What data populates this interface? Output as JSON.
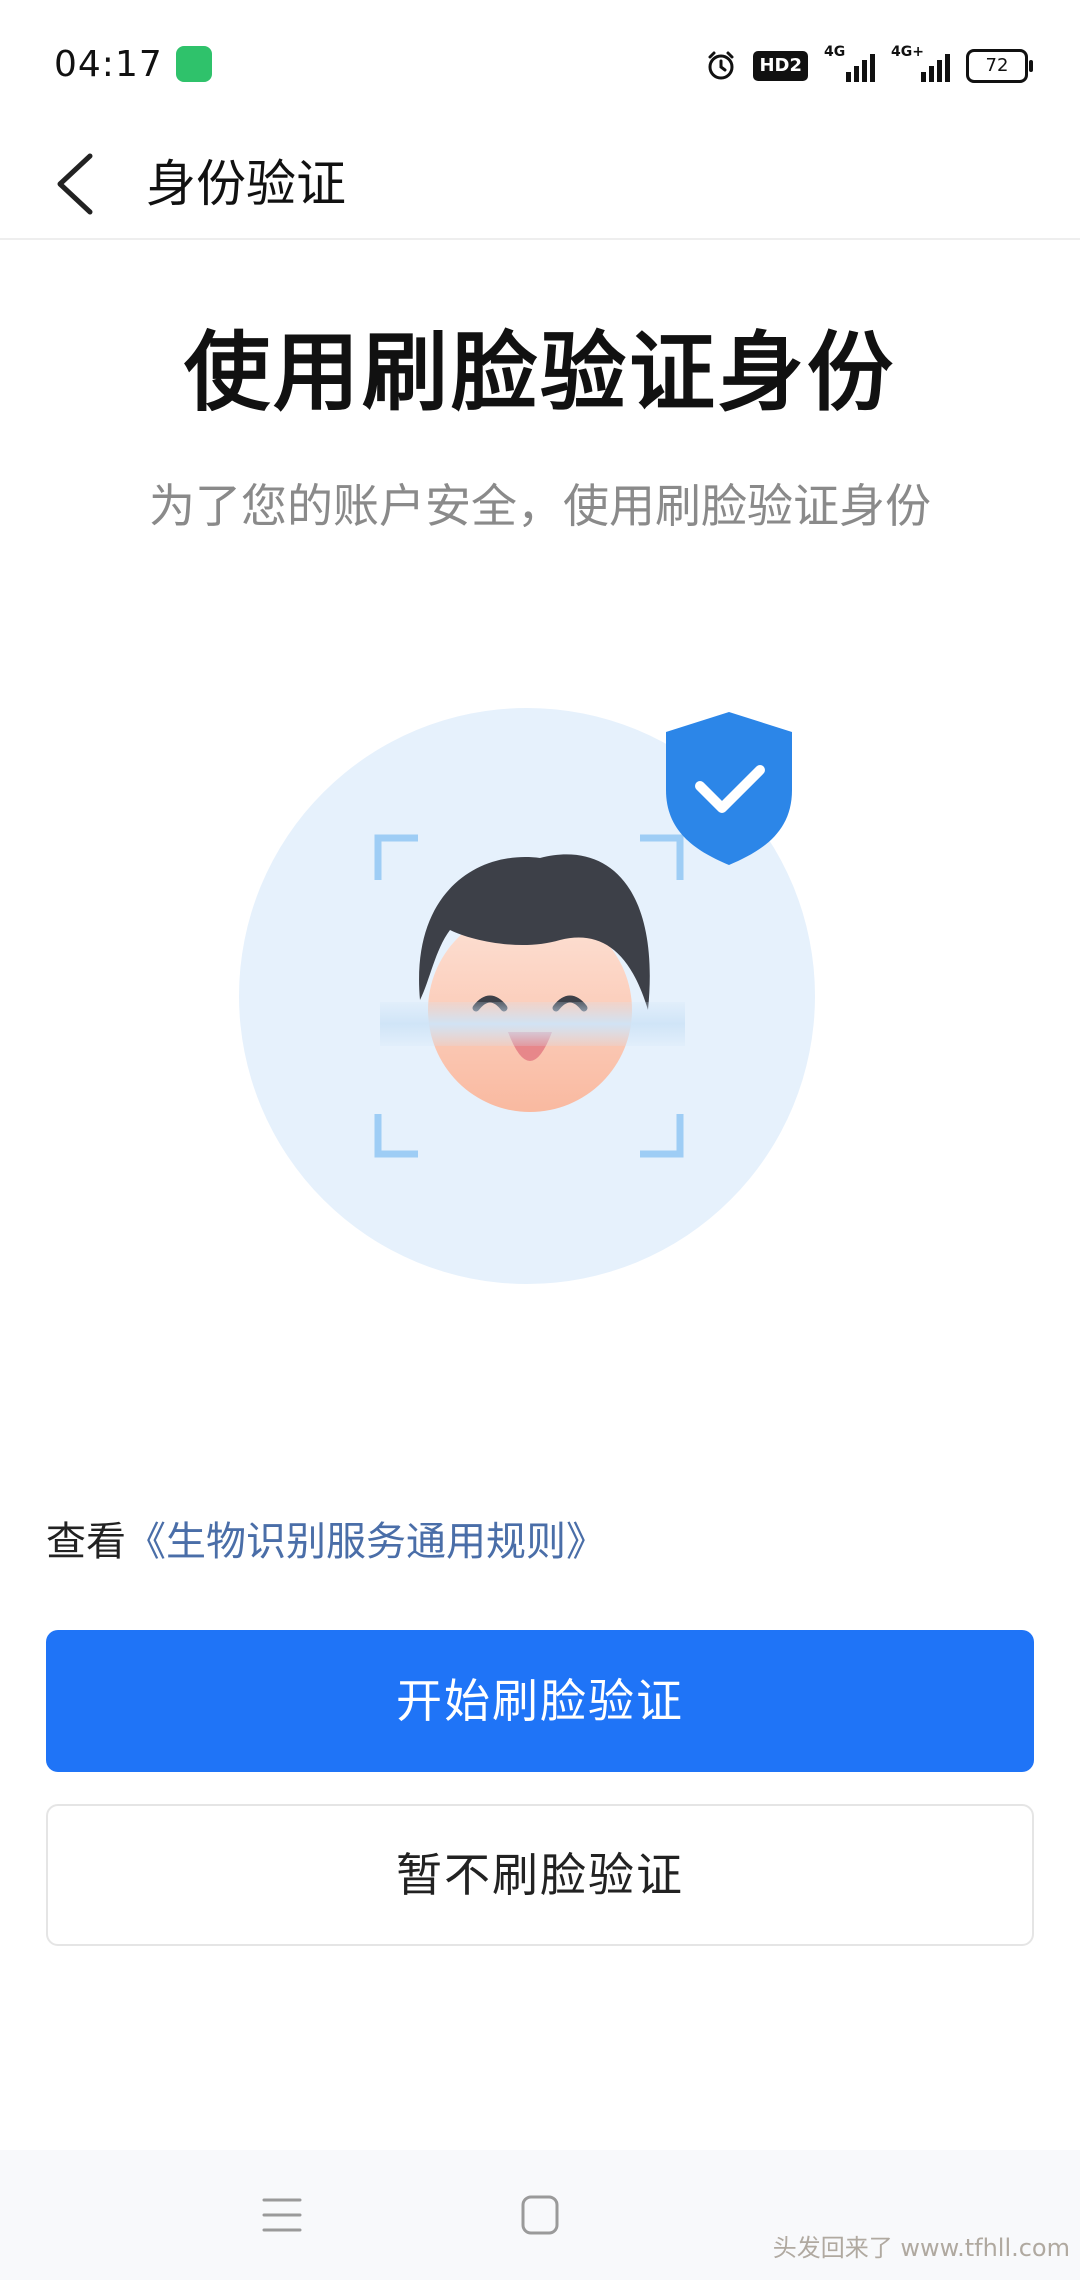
{
  "status_bar": {
    "time": "04:17",
    "hd_label": "HD2",
    "network_1": "4G",
    "network_2": "4G+",
    "battery": "72"
  },
  "header": {
    "title": "身份验证",
    "back_icon": "chevron-left-icon"
  },
  "main": {
    "title": "使用刷脸验证身份",
    "subtitle": "为了您的账户安全，使用刷脸验证身份",
    "illustration": {
      "icons": [
        "face-scan-illustration",
        "shield-check-icon"
      ],
      "circle_color": "#e6f1fc",
      "shield_color": "#2c86e8",
      "frame_color": "#9ecdf5"
    }
  },
  "agreement": {
    "prefix": "查看",
    "link_text": "《生物识别服务通用规则》"
  },
  "buttons": {
    "start_label": "开始刷脸验证",
    "skip_label": "暂不刷脸验证"
  },
  "colors": {
    "primary": "#1f74f7",
    "link": "#4a6ea8",
    "subtitle": "#8a8a8a"
  },
  "nav_bar": {
    "icons": [
      "menu-icon",
      "home-icon"
    ]
  },
  "watermark": "头发回来了 www.tfhll.com"
}
